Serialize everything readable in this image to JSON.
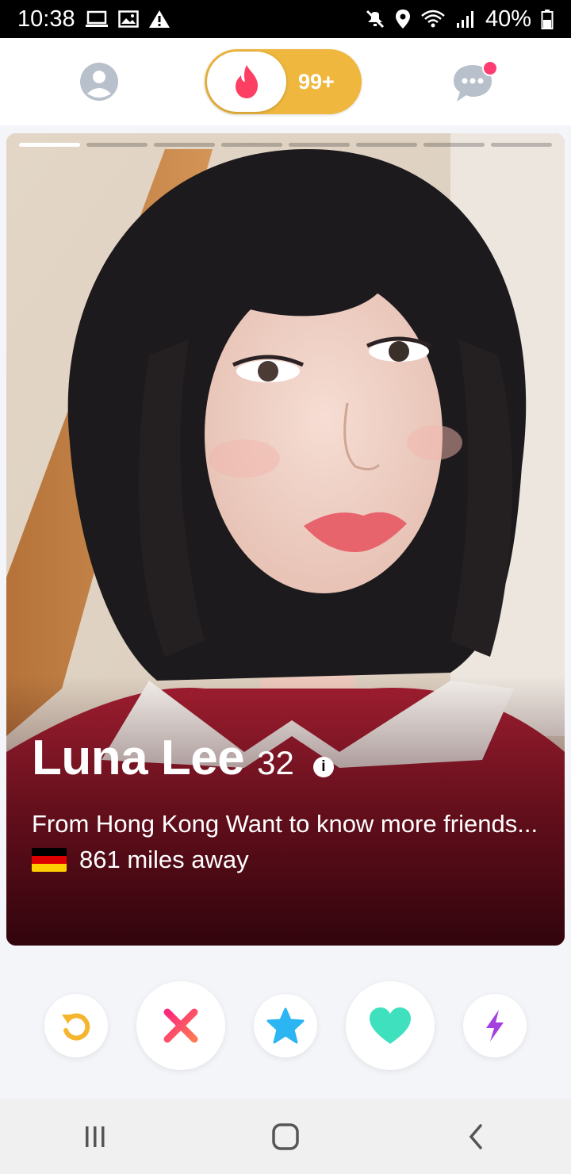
{
  "status_bar": {
    "time": "10:38",
    "battery": "40%",
    "left_icons": [
      "laptop-icon",
      "image-icon",
      "warning-icon"
    ],
    "right_icons": [
      "mute-icon",
      "location-icon",
      "wifi-icon",
      "signal-icon",
      "battery-icon"
    ]
  },
  "top_nav": {
    "profile_icon": "profile-icon",
    "toggle": {
      "icon": "flame-icon",
      "count": "99+"
    },
    "messages_icon": "chat-icon",
    "has_notification": true
  },
  "card": {
    "photos_total": 8,
    "photo_index": 1,
    "name": "Luna Lee",
    "age": "32",
    "bio": "From Hong Kong  Want to know more friends...",
    "distance": "861 miles away",
    "flag": "germany-flag-icon"
  },
  "actions": [
    {
      "name": "rewind",
      "icon": "rewind-icon",
      "color": "#f5b52e"
    },
    {
      "name": "nope",
      "icon": "x-icon",
      "color": "#fd4e64"
    },
    {
      "name": "super-like",
      "icon": "star-icon",
      "color": "#2cb5f3"
    },
    {
      "name": "like",
      "icon": "heart-icon",
      "color": "#3fe0bd"
    },
    {
      "name": "boost",
      "icon": "lightning-icon",
      "color": "#a440e0"
    }
  ],
  "colors": {
    "brand": "#fe3c72",
    "gold": "#efb73e"
  }
}
